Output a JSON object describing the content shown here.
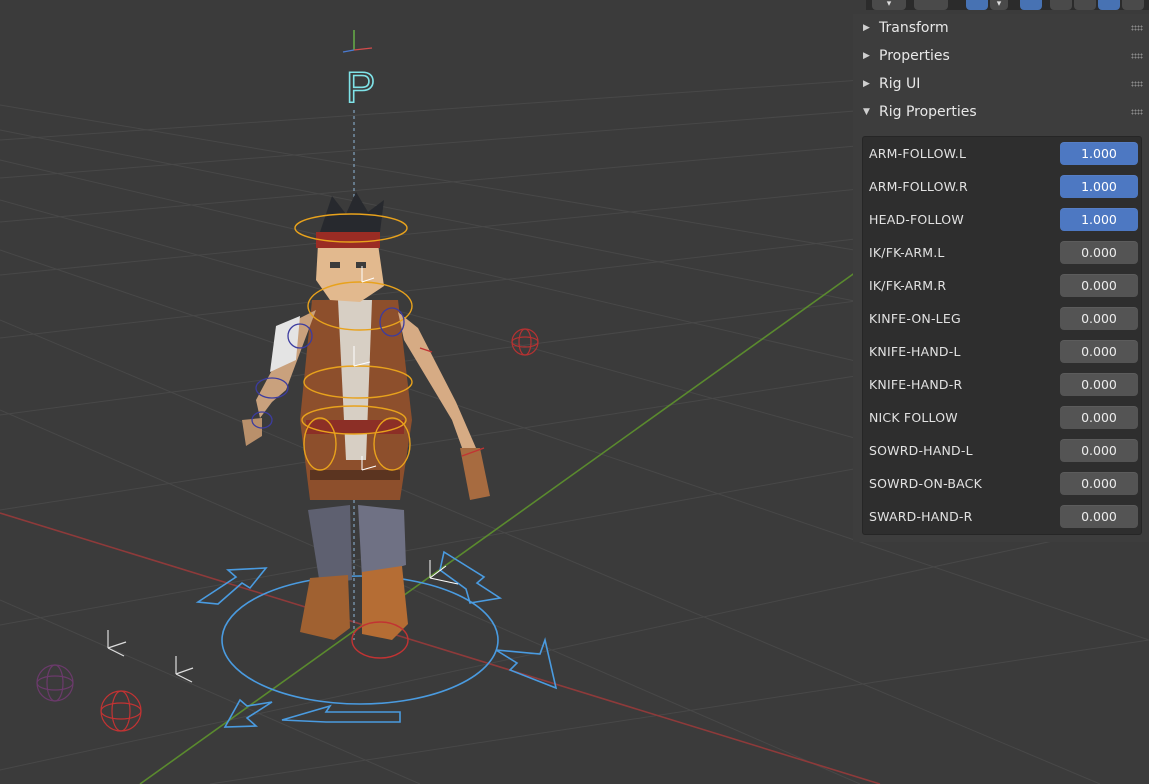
{
  "viewport": {
    "bone_group_label": "P"
  },
  "header": {
    "buttons": [
      {
        "icon": "select-cursor-icon",
        "active": false
      },
      {
        "icon": "bone-tools-icon",
        "active": false
      },
      {
        "icon": "overlay-icon",
        "active": true
      },
      {
        "icon": "xray-icon",
        "active": true
      },
      {
        "icon": "wireframe-shading-icon",
        "active": false
      },
      {
        "icon": "solid-shading-icon",
        "active": false
      },
      {
        "icon": "material-shading-icon",
        "active": true
      },
      {
        "icon": "rendered-shading-icon",
        "active": false
      }
    ]
  },
  "sidebar": {
    "panels": [
      {
        "label": "Transform",
        "expanded": false
      },
      {
        "label": "Properties",
        "expanded": false
      },
      {
        "label": "Rig UI",
        "expanded": false
      },
      {
        "label": "Rig Properties",
        "expanded": true
      }
    ],
    "rig_properties": [
      {
        "name": "ARM-FOLLOW.L",
        "value": "1.000",
        "on": true
      },
      {
        "name": "ARM-FOLLOW.R",
        "value": "1.000",
        "on": true
      },
      {
        "name": "HEAD-FOLLOW",
        "value": "1.000",
        "on": true
      },
      {
        "name": "IK/FK-ARM.L",
        "value": "0.000",
        "on": false
      },
      {
        "name": "IK/FK-ARM.R",
        "value": "0.000",
        "on": false
      },
      {
        "name": "KINFE-ON-LEG",
        "value": "0.000",
        "on": false
      },
      {
        "name": "KNIFE-HAND-L",
        "value": "0.000",
        "on": false
      },
      {
        "name": "KNIFE-HAND-R",
        "value": "0.000",
        "on": false
      },
      {
        "name": "NICK FOLLOW",
        "value": "0.000",
        "on": false
      },
      {
        "name": "SOWRD-HAND-L",
        "value": "0.000",
        "on": false
      },
      {
        "name": "SOWRD-ON-BACK",
        "value": "0.000",
        "on": false
      },
      {
        "name": "SWARD-HAND-R",
        "value": "0.000",
        "on": false
      }
    ]
  },
  "colors": {
    "viewport_bg": "#3b3b3b",
    "grid": "#484848",
    "x_axis": "#8e3a3a",
    "y_axis": "#5a8a2e",
    "active_value": "#4d78c2",
    "idle_value": "#545454",
    "rig_orange": "#e8a21c",
    "root_control_blue": "#4a9be0"
  }
}
